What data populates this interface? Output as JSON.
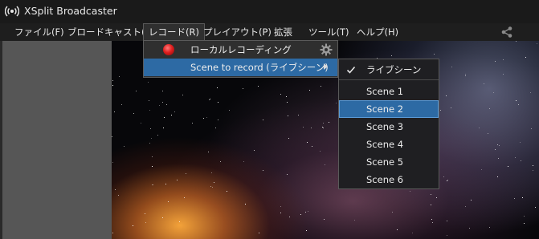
{
  "window": {
    "title": "XSplit Broadcaster",
    "app_icon": "broadcast-icon"
  },
  "menubar": {
    "items": [
      {
        "label": "ファイル(F)"
      },
      {
        "label": "ブロードキャスト(B)"
      },
      {
        "label": "レコード(R)",
        "active": true
      },
      {
        "label": "プレイアウト(P)"
      },
      {
        "label": "拡張"
      },
      {
        "label": "ツール(T)"
      },
      {
        "label": "ヘルプ(H)"
      }
    ],
    "share_icon": "share-icon"
  },
  "record_menu": {
    "items": [
      {
        "label": "ローカルレコーディング",
        "icon": "record-dot-icon",
        "settings_icon": "gear-icon"
      },
      {
        "label": "Scene to record (ライブシーン)",
        "highlighted": true,
        "has_submenu": true
      }
    ]
  },
  "scene_submenu": {
    "items": [
      {
        "label": "ライブシーン",
        "checked": true
      },
      {
        "label": "Scene 1"
      },
      {
        "label": "Scene 2",
        "selected": true
      },
      {
        "label": "Scene 3"
      },
      {
        "label": "Scene 4"
      },
      {
        "label": "Scene 5"
      },
      {
        "label": "Scene 6"
      }
    ]
  },
  "colors": {
    "highlight": "#2d6aa4",
    "menu_bg": "#2f2f2f",
    "panel": "#565656",
    "record_red": "#e02020"
  }
}
